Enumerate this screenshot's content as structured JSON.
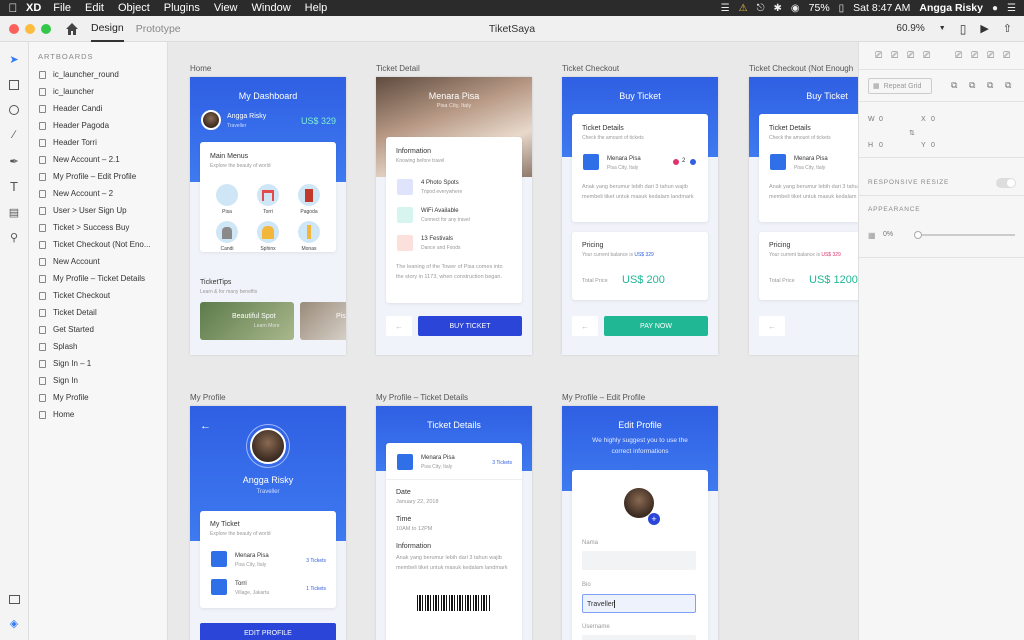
{
  "menubar": {
    "app_name": "XD",
    "menus": [
      "File",
      "Edit",
      "Object",
      "Plugins",
      "View",
      "Window",
      "Help"
    ],
    "battery": "75%",
    "clock": "Sat 8:47 AM",
    "user": "Angga Risky"
  },
  "titlebar": {
    "tabs": [
      "Design",
      "Prototype"
    ],
    "doc_title": "TiketSaya",
    "zoom": "60.9%"
  },
  "layers": {
    "header": "ARTBOARDS",
    "items": [
      "ic_launcher_round",
      "ic_launcher",
      "Header Candi",
      "Header Pagoda",
      "Header Torri",
      "New Account – 2.1",
      "My Profile – Edit Profile",
      "New Account – 2",
      "User > User Sign Up",
      "Ticket > Success Buy",
      "Ticket Checkout (Not Eno...",
      "New Account",
      "My Profile – Ticket Details",
      "Ticket Checkout",
      "Ticket Detail",
      "Get Started",
      "Splash",
      "Sign In – 1",
      "Sign In",
      "My Profile",
      "Home"
    ]
  },
  "artboards": {
    "home": {
      "label": "Home",
      "title": "My Dashboard",
      "user": "Angga Risky",
      "role": "Traveller",
      "balance": "US$ 329",
      "menu_title": "Main Menus",
      "menu_sub": "Explore the beauty of world",
      "menus": [
        "Pisa",
        "Torri",
        "Pagoda",
        "Candi",
        "Sphinx",
        "Monas"
      ],
      "tips_title": "TicketTips",
      "tips_sub": "Learn & for many benefits",
      "tip1_title": "Beautiful Spot",
      "tip1_sub": "Learn More",
      "tip2_title": "Pis"
    },
    "ticket_detail": {
      "label": "Ticket Detail",
      "title": "Menara Pisa",
      "subtitle": "Pisa City, Italy",
      "info_title": "Information",
      "info_sub": "Knowing before travel",
      "features": [
        {
          "title": "4 Photo Spots",
          "sub": "Tripod everywhere"
        },
        {
          "title": "WiFi Available",
          "sub": "Connect for any travel"
        },
        {
          "title": "13 Festivals",
          "sub": "Dance and Foods"
        }
      ],
      "desc": "The leaning of the Tower of Pisa comes into the story in 1173, when construction began.",
      "button": "BUY TICKET"
    },
    "checkout": {
      "label": "Ticket Checkout",
      "title": "Buy Ticket",
      "details_title": "Ticket Details",
      "details_sub": "Check the amount of tickets",
      "item": "Menara Pisa",
      "item_sub": "Pisa City, Italy",
      "qty": "2",
      "desc": "Anak yang berumur lebih dari 3 tahun wajib membeli tiket untuk masuk kedalam landmark",
      "pricing_title": "Pricing",
      "pricing_sub": "Your current balance is",
      "pricing_balance": "US$ 329",
      "total_label": "Total Price",
      "total": "US$ 200",
      "button": "PAY NOW"
    },
    "checkout_ne": {
      "label": "Ticket Checkout (Not Enough",
      "title": "Buy Ticket",
      "details_title": "Ticket Details",
      "details_sub": "Check the amount of tickets",
      "item": "Menara Pisa",
      "item_sub": "Pisa City, Italy",
      "desc": "Anak yang berumur lebih dari 3 tahun wajib membeli tiket untuk masuk kedalam landmark",
      "pricing_title": "Pricing",
      "pricing_sub": "Your current balance is",
      "pricing_balance": "US$ 329",
      "total_label": "Total Price",
      "total": "US$ 1200"
    },
    "profile": {
      "label": "My Profile",
      "name": "Angga Risky",
      "role": "Traveller",
      "ticket_title": "My Ticket",
      "ticket_sub": "Explore the beauty of world",
      "tickets": [
        {
          "name": "Menara Pisa",
          "sub": "Pisa City, Italy",
          "count": "3 Tickets"
        },
        {
          "name": "Torri",
          "sub": "Village, Jakarta",
          "count": "1 Tickets"
        }
      ],
      "button": "EDIT PROFILE"
    },
    "profile_ticket": {
      "label": "My Profile – Ticket Details",
      "title": "Ticket Details",
      "item": "Menara Pisa",
      "item_sub": "Pisa City, Italy",
      "count": "3 Tickets",
      "date_label": "Date",
      "date": "January 22, 2018",
      "time_label": "Time",
      "time": "10AM to 12PM",
      "info_label": "Information",
      "info": "Anak yang berumur lebih dari 3 tahun wajib membeli tiket untuk masuk kedalam landmark"
    },
    "edit_profile": {
      "label": "My Profile – Edit Profile",
      "title": "Edit Profile",
      "subtitle": "We highly suggest you to use the correct informations",
      "name_label": "Nama",
      "bio_label": "Bio",
      "bio_value": "Traveller",
      "username_label": "Username"
    }
  },
  "props": {
    "repeat_grid": "Repeat Grid",
    "w_label": "W",
    "w_value": "0",
    "x_label": "X",
    "x_value": "0",
    "h_label": "H",
    "h_value": "0",
    "y_label": "Y",
    "y_value": "0",
    "responsive": "RESPONSIVE RESIZE",
    "appearance": "APPEARANCE",
    "opacity": "0%"
  },
  "colors": {
    "accent": "#2f5fe3",
    "button_blue": "#2a45d8",
    "button_green": "#20b795"
  }
}
